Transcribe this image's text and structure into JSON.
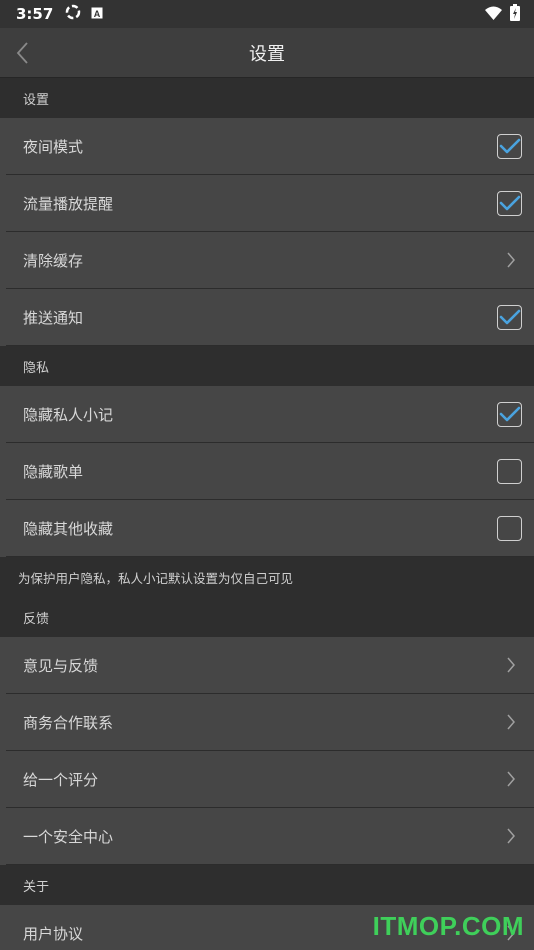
{
  "status_bar": {
    "time": "3:57",
    "icons": [
      "sync-icon",
      "a-badge-icon",
      "wifi-icon",
      "battery-charging-icon"
    ]
  },
  "header": {
    "title": "设置"
  },
  "sections": [
    {
      "title": "设置",
      "rows": [
        {
          "label": "夜间模式",
          "control": "checkbox",
          "checked": true
        },
        {
          "label": "流量播放提醒",
          "control": "checkbox",
          "checked": true
        },
        {
          "label": "清除缓存",
          "control": "chevron"
        },
        {
          "label": "推送通知",
          "control": "checkbox",
          "checked": true
        }
      ]
    },
    {
      "title": "隐私",
      "rows": [
        {
          "label": "隐藏私人小记",
          "control": "checkbox",
          "checked": true
        },
        {
          "label": "隐藏歌单",
          "control": "checkbox",
          "checked": false
        },
        {
          "label": "隐藏其他收藏",
          "control": "checkbox",
          "checked": false
        }
      ],
      "note": "为保护用户隐私，私人小记默认设置为仅自己可见"
    },
    {
      "title": "反馈",
      "rows": [
        {
          "label": "意见与反馈",
          "control": "chevron"
        },
        {
          "label": "商务合作联系",
          "control": "chevron"
        },
        {
          "label": "给一个评分",
          "control": "chevron"
        },
        {
          "label": "一个安全中心",
          "control": "chevron"
        }
      ]
    },
    {
      "title": "关于",
      "rows": [
        {
          "label": "用户协议",
          "control": "chevron"
        }
      ]
    }
  ],
  "watermark": "ITMOP.COM",
  "colors": {
    "check_accent": "#4aa3df",
    "background": "#2e2e2e",
    "row_background": "#464646",
    "watermark": "#3fcf5a"
  }
}
